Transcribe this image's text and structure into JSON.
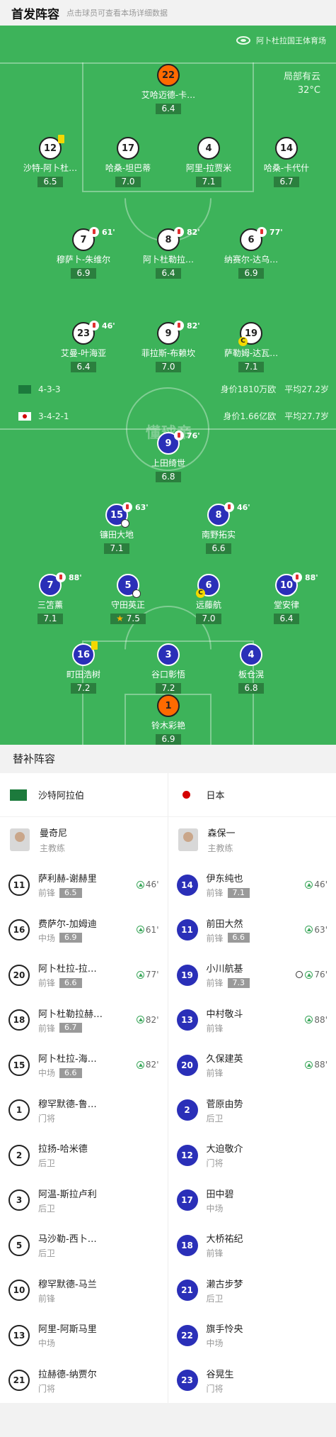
{
  "header": {
    "title": "首发阵容",
    "subtitle": "点击球员可查看本场详细数据"
  },
  "venue": {
    "stadium": "阿卜杜拉国王体育场",
    "weather": "局部有云",
    "temp": "32°C"
  },
  "watermark": "懂球帝",
  "home": {
    "formation": "4-3-3",
    "value": "身价1810万欧",
    "age": "平均27.2岁",
    "players": [
      {
        "num": "22",
        "name": "艾哈迈德-卡…",
        "rating": "6.4"
      },
      {
        "num": "12",
        "name": "沙特-阿卜杜…",
        "rating": "6.5"
      },
      {
        "num": "17",
        "name": "哈桑-坦巴蒂",
        "rating": "7.0"
      },
      {
        "num": "4",
        "name": "阿里-拉贾米",
        "rating": "7.1"
      },
      {
        "num": "14",
        "name": "哈桑-卡代什",
        "rating": "6.7"
      },
      {
        "num": "7",
        "name": "穆萨卜-朱维尔",
        "rating": "6.9",
        "sub": "61'"
      },
      {
        "num": "8",
        "name": "阿卜杜勒拉…",
        "rating": "6.4",
        "sub": "82'"
      },
      {
        "num": "6",
        "name": "纳赛尔-达乌…",
        "rating": "6.9",
        "sub": "77'"
      },
      {
        "num": "23",
        "name": "艾曼-叶海亚",
        "rating": "6.4",
        "sub": "46'"
      },
      {
        "num": "9",
        "name": "菲拉斯-布赖坎",
        "rating": "7.0",
        "sub": "82'"
      },
      {
        "num": "19",
        "name": "萨勒姆-达瓦…",
        "rating": "7.1"
      }
    ]
  },
  "away": {
    "formation": "3-4-2-1",
    "value": "身价1.66亿欧",
    "age": "平均27.7岁",
    "players": [
      {
        "num": "9",
        "name": "上田绮世",
        "rating": "6.8",
        "sub": "76'"
      },
      {
        "num": "15",
        "name": "镰田大地",
        "rating": "7.1",
        "sub": "63'"
      },
      {
        "num": "8",
        "name": "南野拓实",
        "rating": "6.6",
        "sub": "46'"
      },
      {
        "num": "7",
        "name": "三笘薰",
        "rating": "7.1",
        "sub": "88'"
      },
      {
        "num": "5",
        "name": "守田英正",
        "rating": "7.5"
      },
      {
        "num": "6",
        "name": "远藤航",
        "rating": "7.0"
      },
      {
        "num": "10",
        "name": "堂安律",
        "rating": "6.4",
        "sub": "88'"
      },
      {
        "num": "16",
        "name": "町田浩树",
        "rating": "7.2"
      },
      {
        "num": "3",
        "name": "谷口彰悟",
        "rating": "7.2"
      },
      {
        "num": "4",
        "name": "板仓滉",
        "rating": "6.8"
      },
      {
        "num": "1",
        "name": "铃木彩艳",
        "rating": "6.9"
      }
    ]
  },
  "subs": {
    "title": "替补阵容",
    "home_team": "沙特阿拉伯",
    "away_team": "日本",
    "home_coach": {
      "name": "曼奇尼",
      "role": "主教练"
    },
    "away_coach": {
      "name": "森保一",
      "role": "主教练"
    },
    "home": [
      {
        "num": "11",
        "name": "萨利赫-谢赫里",
        "pos": "前锋",
        "rating": "6.5",
        "in": "46'"
      },
      {
        "num": "16",
        "name": "费萨尔-加姆迪",
        "pos": "中场",
        "rating": "6.9",
        "in": "61'"
      },
      {
        "num": "20",
        "name": "阿卜杜拉-拉…",
        "pos": "前锋",
        "rating": "6.6",
        "in": "77'"
      },
      {
        "num": "18",
        "name": "阿卜杜勒拉赫…",
        "pos": "前锋",
        "rating": "6.7",
        "in": "82'"
      },
      {
        "num": "15",
        "name": "阿卜杜拉-海…",
        "pos": "中场",
        "rating": "6.6",
        "in": "82'"
      },
      {
        "num": "1",
        "name": "穆罕默德-鲁…",
        "pos": "门将"
      },
      {
        "num": "2",
        "name": "拉扬-哈米德",
        "pos": "后卫"
      },
      {
        "num": "3",
        "name": "阿温-斯拉卢利",
        "pos": "后卫"
      },
      {
        "num": "5",
        "name": "马沙勒-西卜…",
        "pos": "后卫"
      },
      {
        "num": "10",
        "name": "穆罕默德-马兰",
        "pos": "前锋"
      },
      {
        "num": "13",
        "name": "阿里-阿斯马里",
        "pos": "中场"
      },
      {
        "num": "21",
        "name": "拉赫德-纳贾尔",
        "pos": "门将"
      }
    ],
    "away": [
      {
        "num": "14",
        "name": "伊东纯也",
        "pos": "前锋",
        "rating": "7.1",
        "in": "46'"
      },
      {
        "num": "11",
        "name": "前田大然",
        "pos": "前锋",
        "rating": "6.6",
        "in": "63'"
      },
      {
        "num": "19",
        "name": "小川航基",
        "pos": "前锋",
        "rating": "7.3",
        "in": "76'",
        "goal": true
      },
      {
        "num": "13",
        "name": "中村敬斗",
        "pos": "前锋",
        "in": "88'"
      },
      {
        "num": "20",
        "name": "久保建英",
        "pos": "前锋",
        "in": "88'"
      },
      {
        "num": "2",
        "name": "菅原由势",
        "pos": "后卫"
      },
      {
        "num": "12",
        "name": "大迫敬介",
        "pos": "门将"
      },
      {
        "num": "17",
        "name": "田中碧",
        "pos": "中场"
      },
      {
        "num": "18",
        "name": "大桥祐纪",
        "pos": "前锋"
      },
      {
        "num": "21",
        "name": "濑古步梦",
        "pos": "后卫"
      },
      {
        "num": "22",
        "name": "旗手怜央",
        "pos": "中场"
      },
      {
        "num": "23",
        "name": "谷晃生",
        "pos": "门将"
      }
    ]
  }
}
